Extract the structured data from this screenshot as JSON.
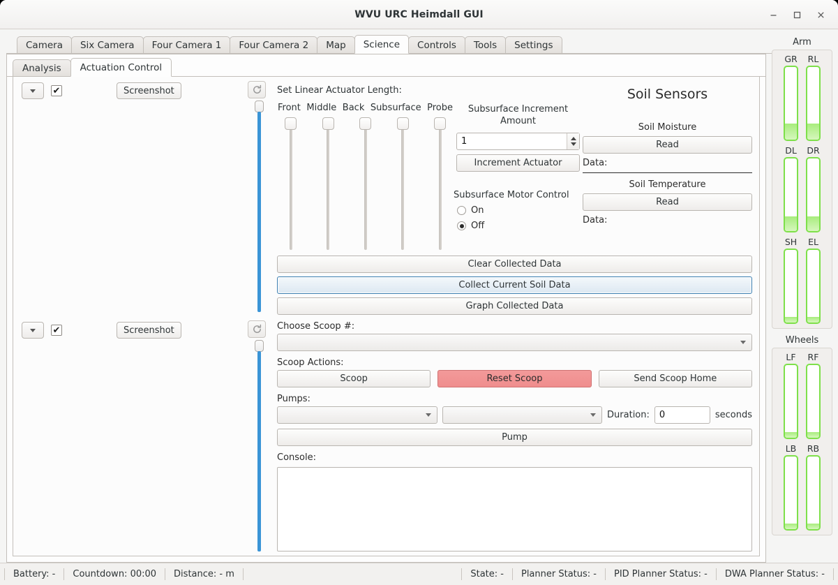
{
  "window": {
    "title": "WVU URC Heimdall GUI",
    "controls": [
      {
        "name": "minimize-button",
        "glyph": "minimize"
      },
      {
        "name": "maximize-button",
        "glyph": "maximize"
      },
      {
        "name": "close-button",
        "glyph": "close"
      }
    ]
  },
  "main_tabs": [
    {
      "label": "Camera",
      "active": false
    },
    {
      "label": "Six Camera",
      "active": false
    },
    {
      "label": "Four Camera 1",
      "active": false
    },
    {
      "label": "Four Camera 2",
      "active": false
    },
    {
      "label": "Map",
      "active": false
    },
    {
      "label": "Science",
      "active": true
    },
    {
      "label": "Controls",
      "active": false
    },
    {
      "label": "Tools",
      "active": false
    },
    {
      "label": "Settings",
      "active": false
    }
  ],
  "sub_tabs": [
    {
      "label": "Analysis",
      "active": false
    },
    {
      "label": "Actuation Control",
      "active": true
    }
  ],
  "cameras": [
    {
      "screenshot_label": "Screenshot",
      "checkbox_checked": true,
      "checkbox_glyph": "✔",
      "refresh_icon": "refresh-icon",
      "dropdown_value": ""
    },
    {
      "screenshot_label": "Screenshot",
      "checkbox_checked": true,
      "checkbox_glyph": "✔",
      "refresh_icon": "refresh-icon",
      "dropdown_value": ""
    }
  ],
  "actuators": {
    "section_label": "Set Linear Actuator Length:",
    "names": [
      "Front",
      "Middle",
      "Back",
      "Subsurface",
      "Probe"
    ],
    "values": [
      0,
      0,
      0,
      0,
      0
    ]
  },
  "increment": {
    "title_line1": "Subsurface Increment",
    "title_line2": "Amount",
    "spinner_value": "1",
    "button_label": "Increment Actuator"
  },
  "motor_control": {
    "title": "Subsurface Motor Control",
    "options": [
      {
        "label": "On",
        "selected": false
      },
      {
        "label": "Off",
        "selected": true
      }
    ]
  },
  "soil_sensors": {
    "title": "Soil Sensors",
    "moisture": {
      "label": "Soil Moisture",
      "button": "Read",
      "data_label": "Data:",
      "data_value": ""
    },
    "temperature": {
      "label": "Soil Temperature",
      "button": "Read",
      "data_label": "Data:",
      "data_value": ""
    }
  },
  "data_buttons": [
    {
      "label": "Clear Collected Data",
      "style": "normal"
    },
    {
      "label": "Collect Current Soil Data",
      "style": "focused"
    },
    {
      "label": "Graph Collected Data",
      "style": "normal"
    }
  ],
  "scoop": {
    "choose_label": "Choose Scoop #:",
    "choose_value": "",
    "actions_label": "Scoop Actions:",
    "actions": [
      {
        "label": "Scoop",
        "style": "normal"
      },
      {
        "label": "Reset Scoop",
        "style": "danger"
      },
      {
        "label": "Send Scoop Home",
        "style": "normal"
      }
    ]
  },
  "pumps": {
    "label": "Pumps:",
    "select_a_value": "",
    "select_b_value": "",
    "duration_label": "Duration:",
    "duration_value": "0",
    "duration_unit": "seconds",
    "pump_button": "Pump"
  },
  "console": {
    "label": "Console:",
    "text": ""
  },
  "sidebar": {
    "arm": {
      "title": "Arm",
      "rows": [
        {
          "bars": [
            {
              "label": "GR",
              "fill_pct": 22
            },
            {
              "label": "RL",
              "fill_pct": 22
            }
          ]
        },
        {
          "bars": [
            {
              "label": "DL",
              "fill_pct": 20
            },
            {
              "label": "DR",
              "fill_pct": 20
            }
          ]
        },
        {
          "bars": [
            {
              "label": "SH",
              "fill_pct": 8
            },
            {
              "label": "EL",
              "fill_pct": 8
            }
          ]
        }
      ]
    },
    "wheels": {
      "title": "Wheels",
      "rows": [
        {
          "bars": [
            {
              "label": "LF",
              "fill_pct": 8
            },
            {
              "label": "RF",
              "fill_pct": 8
            }
          ]
        },
        {
          "bars": [
            {
              "label": "LB",
              "fill_pct": 8
            },
            {
              "label": "RB",
              "fill_pct": 8
            }
          ]
        }
      ]
    }
  },
  "statusbar": [
    {
      "label": "Battery:  -"
    },
    {
      "label": "Countdown:  00:00"
    },
    {
      "label": "Distance:  - m"
    },
    {
      "label": "State:  -"
    },
    {
      "label": "Planner Status:  -"
    },
    {
      "label": "PID Planner Status:  -"
    },
    {
      "label": "DWA Planner Status:  -"
    }
  ],
  "colors": {
    "accent_blue": "#3a94d6",
    "focus_blue": "#3c7fb1",
    "danger_red": "#ef8d8d",
    "bar_green": "#7ee04a",
    "bar_fill_green": "#a8ec7d"
  }
}
